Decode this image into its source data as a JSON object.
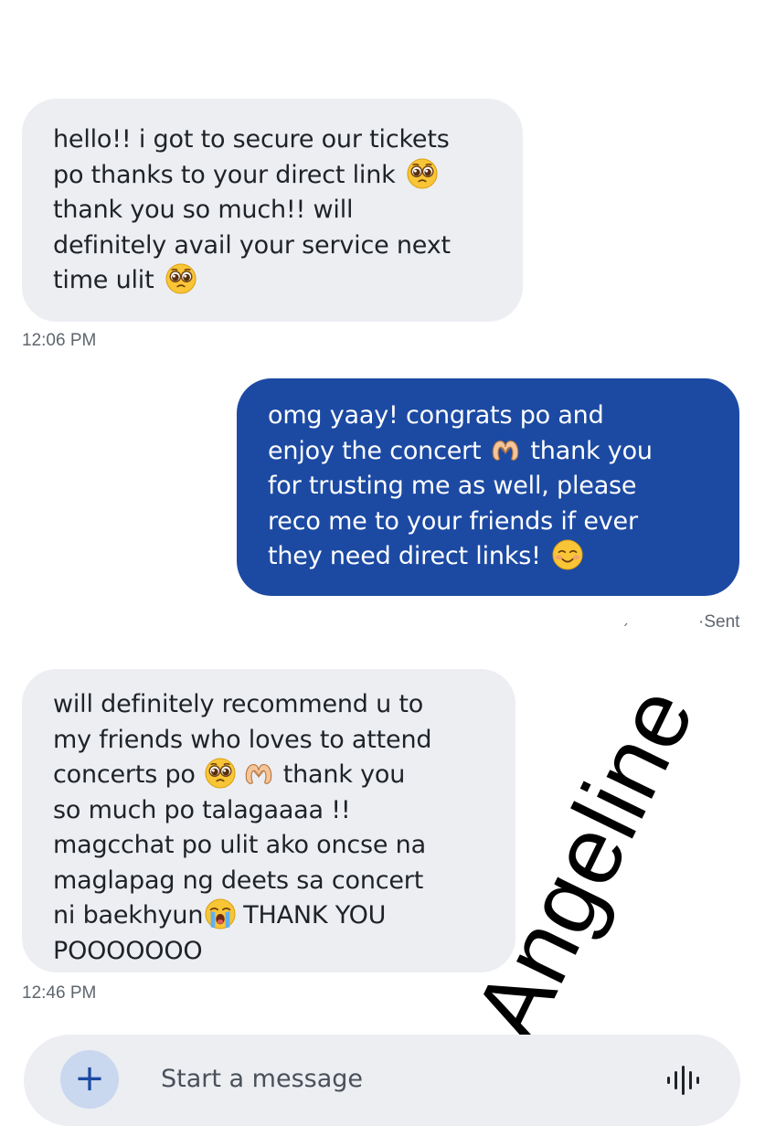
{
  "messages": [
    {
      "direction": "incoming",
      "lines": [
        "hello!! i got to secure our tickets",
        "po thanks to your direct link",
        "thank you so much!! will",
        "definitely avail your service next",
        "time ulit"
      ],
      "time": "12:06 PM"
    },
    {
      "direction": "outgoing",
      "lines": [
        "omg yaay! congrats po and",
        "enjoy the concert",
        "thank you",
        "for trusting me as well, please",
        "reco me to your friends if ever",
        "they need direct links!"
      ],
      "status_mark": "ˏ",
      "status": "·Sent"
    },
    {
      "direction": "incoming",
      "lines": [
        "will definitely recommend u to",
        "my friends who loves to attend",
        "concerts po",
        "thank you",
        "so much po talagaaaa !!",
        "magcchat po ulit ako oncse na",
        "maglapag ng deets sa concert",
        "ni baekhyun",
        "THANK YOU",
        "POOOOOOO"
      ],
      "time": "12:46 PM"
    }
  ],
  "emojis": {
    "pleading": "pleading-face-icon",
    "heart_hands": "heart-hands-icon",
    "smiling_blush": "smiling-face-icon",
    "crying": "loudly-crying-face-icon"
  },
  "watermark": "Angeline",
  "composer": {
    "placeholder": "Start a message",
    "add_icon": "plus-icon",
    "voice_icon": "voice-waveform-icon"
  },
  "colors": {
    "incoming_bubble": "#eceef2",
    "outgoing_bubble": "#1c4aa3",
    "add_button": "#c9d7ef",
    "accent": "#1c4aa3"
  }
}
